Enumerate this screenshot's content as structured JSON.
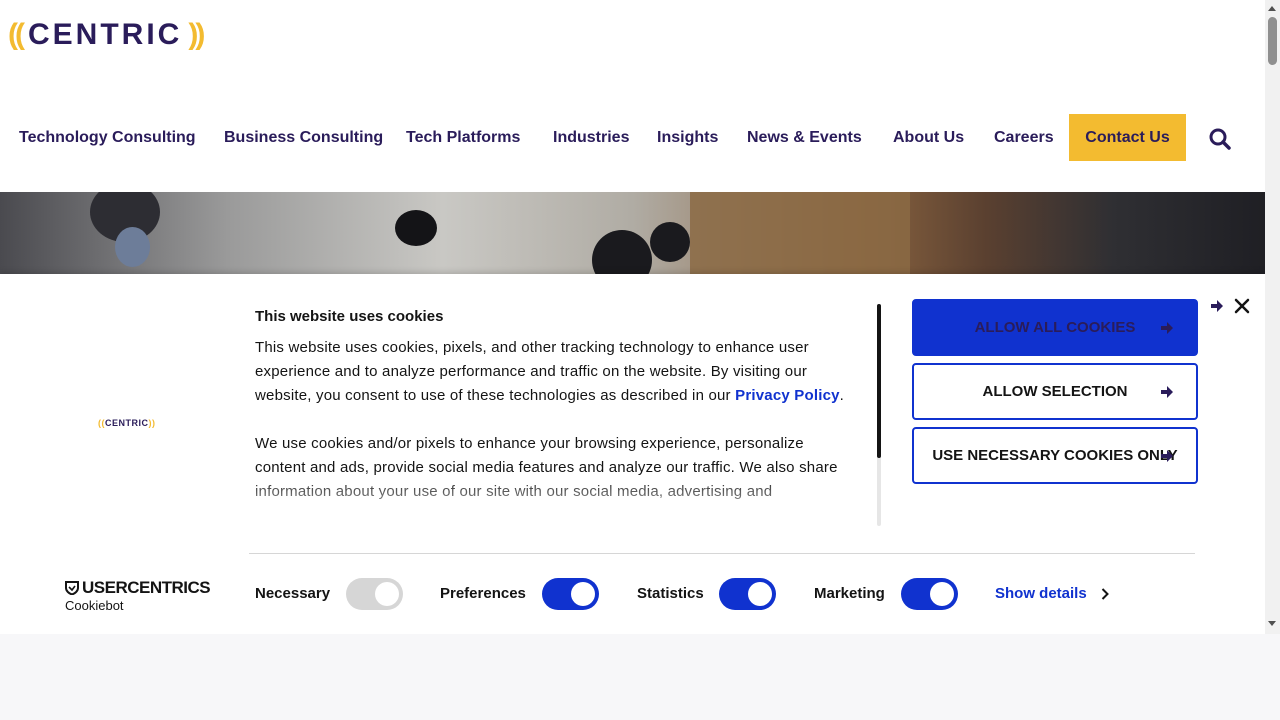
{
  "header": {
    "logo_left_paren": "((",
    "logo_word": "CENTRIC",
    "logo_right_paren": "))"
  },
  "nav": {
    "items": [
      "Technology Consulting",
      "Business Consulting",
      "Tech Platforms",
      "Industries",
      "Insights",
      "News & Events",
      "About Us",
      "Careers"
    ],
    "contact": "Contact Us"
  },
  "cookie": {
    "mini_logo_left": "((",
    "mini_logo_word": "CENTRIC",
    "mini_logo_right": "))",
    "heading": "This website uses cookies",
    "para1_text": "This website uses cookies, pixels, and other tracking technology to enhance user experience and to analyze performance and traffic on the website. By visiting our website, you consent to use of these technologies as described in our ",
    "para1_link": "Privacy Policy",
    "para1_end": ".",
    "para2": "We use cookies and/or pixels to enhance your browsing experience, personalize content and ads, provide social media features and analyze our traffic. We also share information about your use of our site with our social media, advertising and",
    "buttons": {
      "allow_all": "ALLOW ALL COOKIES",
      "allow_selection": "ALLOW SELECTION",
      "necessary_only": "USE NECESSARY COOKIES ONLY"
    },
    "toggles": [
      {
        "label": "Necessary",
        "state": "on-disabled"
      },
      {
        "label": "Preferences",
        "state": "on"
      },
      {
        "label": "Statistics",
        "state": "on"
      },
      {
        "label": "Marketing",
        "state": "on"
      }
    ],
    "show_details": "Show details",
    "brand_line1": "USERCENTRICS",
    "brand_line2": "Cookiebot"
  },
  "colors": {
    "brand_navy": "#2a1c5a",
    "brand_yellow": "#f3bb30",
    "cookie_blue": "#1032cf"
  }
}
